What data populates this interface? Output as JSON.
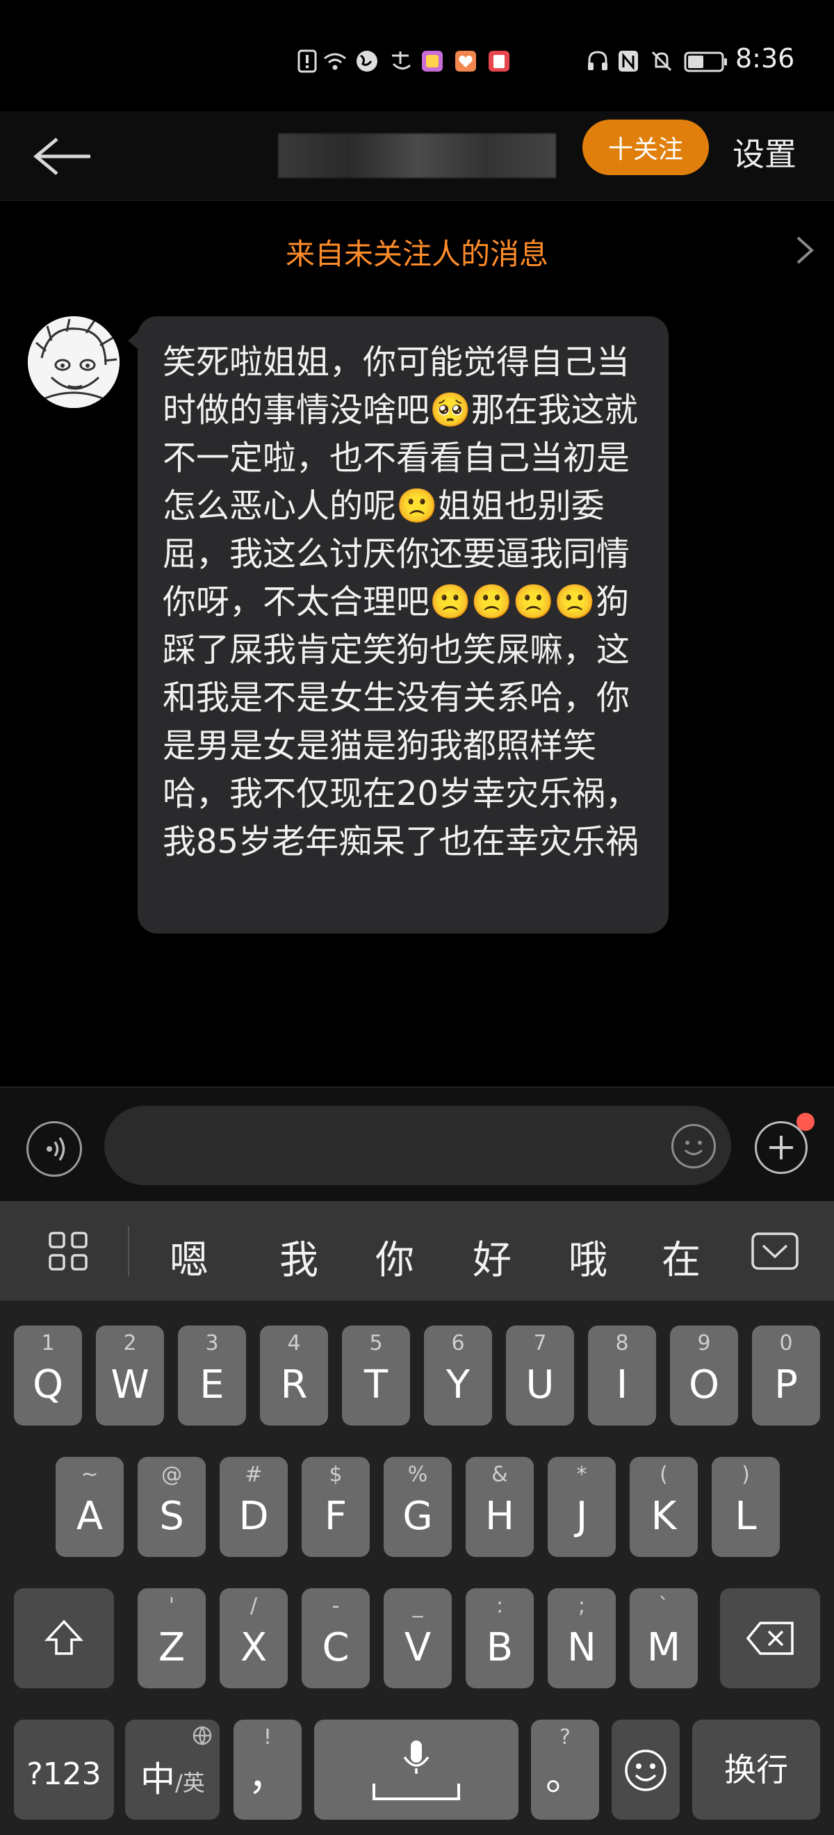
{
  "status_bar": {
    "time": "8:36"
  },
  "header": {
    "follow_label": "十关注",
    "settings_label": "设置"
  },
  "notice": {
    "text": "来自未关注人的消息"
  },
  "message": {
    "text": "笑死啦姐姐，你可能觉得自己当时做的事情没啥吧🥺那在我这就不一定啦，也不看看自己当初是怎么恶心人的呢🙁姐姐也别委屈，我这么讨厌你还要逼我同情你呀，不太合理吧🙁🙁🙁🙁狗踩了屎我肯定笑狗也笑屎嘛，这和我是不是女生没有关系哈，你是男是女是猫是狗我都照样笑哈，我不仅现在20岁幸灾乐祸，我85岁老年痴呆了也在幸灾乐祸"
  },
  "keyboard": {
    "candidates": [
      "嗯",
      "我",
      "你",
      "好",
      "哦",
      "在"
    ],
    "row1": [
      {
        "main": "Q",
        "sub": "1"
      },
      {
        "main": "W",
        "sub": "2"
      },
      {
        "main": "E",
        "sub": "3"
      },
      {
        "main": "R",
        "sub": "4"
      },
      {
        "main": "T",
        "sub": "5"
      },
      {
        "main": "Y",
        "sub": "6"
      },
      {
        "main": "U",
        "sub": "7"
      },
      {
        "main": "I",
        "sub": "8"
      },
      {
        "main": "O",
        "sub": "9"
      },
      {
        "main": "P",
        "sub": "0"
      }
    ],
    "row2": [
      {
        "main": "A",
        "sub": "~"
      },
      {
        "main": "S",
        "sub": "@"
      },
      {
        "main": "D",
        "sub": "#"
      },
      {
        "main": "F",
        "sub": "$"
      },
      {
        "main": "G",
        "sub": "%"
      },
      {
        "main": "H",
        "sub": "&"
      },
      {
        "main": "J",
        "sub": "*"
      },
      {
        "main": "K",
        "sub": "("
      },
      {
        "main": "L",
        "sub": ")"
      }
    ],
    "row3": [
      {
        "main": "Z",
        "sub": "'"
      },
      {
        "main": "X",
        "sub": "/"
      },
      {
        "main": "C",
        "sub": "-"
      },
      {
        "main": "V",
        "sub": "_"
      },
      {
        "main": "B",
        "sub": ":"
      },
      {
        "main": "N",
        "sub": ";"
      },
      {
        "main": "M",
        "sub": "`"
      }
    ],
    "num_label": "?123",
    "lang_main": "中",
    "lang_sub": "/英",
    "comma_main": "，",
    "comma_sub": "!",
    "period_main": "。",
    "period_sub": "?",
    "enter_label": "换行"
  }
}
